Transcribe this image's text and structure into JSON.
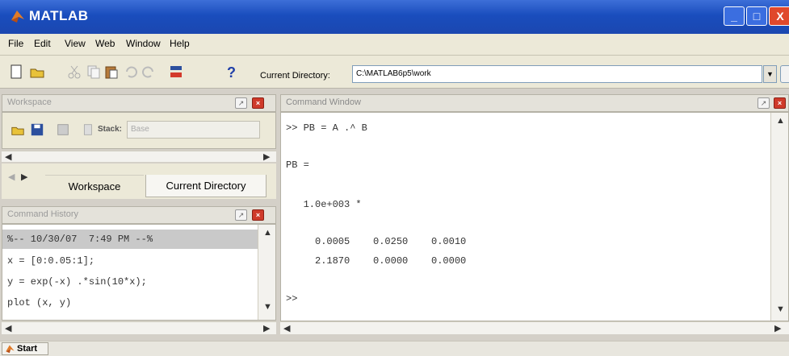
{
  "window": {
    "title": "MATLAB",
    "controls": [
      "_",
      "□",
      "X"
    ]
  },
  "menu": [
    "File",
    "Edit",
    "View",
    "Web",
    "Window",
    "Help"
  ],
  "toolbar": {
    "help_label": "?",
    "current_directory_label": "Current Directory:",
    "current_directory_value": "C:\\MATLAB6p5\\work"
  },
  "workspace": {
    "title": "Workspace",
    "stack_label": "Stack:",
    "stack_value": "Base"
  },
  "tabs": {
    "workspace": "Workspace",
    "current_directory": "Current Directory"
  },
  "history": {
    "title": "Command History",
    "lines": [
      "%-- 10/30/07  7:49 PM --%",
      "x = [0:0.05:1];",
      "y = exp(-x) .*sin(10*x);",
      "plot (x, y)"
    ]
  },
  "command_window": {
    "title": "Command Window",
    "lines": [
      ">> PB = A .^ B",
      "PB =",
      "   1.0e+003 *",
      "     0.0005    0.0250    0.0010",
      "     2.1870    0.0000    0.0000",
      ">>"
    ]
  },
  "taskbar": {
    "start_label": "Start"
  },
  "colors": {
    "title_blue": "#1a4dbd",
    "close_red": "#e0482b",
    "panel_bg": "#ece9d8"
  }
}
